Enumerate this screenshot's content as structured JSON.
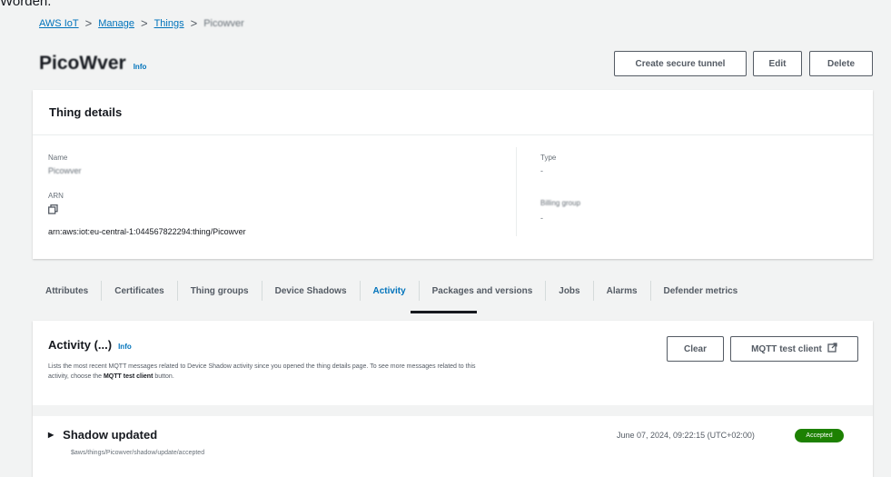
{
  "top_text": "Worden.",
  "breadcrumb": {
    "items": [
      "AWS IoT",
      "Manage",
      "Things"
    ],
    "current": "Picowver"
  },
  "thing": {
    "name": "PicoWver",
    "info_label": "Info"
  },
  "header_buttons": {
    "tunnel": "Create secure tunnel",
    "edit": "Edit",
    "delete": "Delete"
  },
  "details": {
    "title": "Thing details",
    "name_label": "Name",
    "name_value": "Picowver",
    "arn_label": "ARN",
    "arn_value": "arn:aws:iot:eu-central-1:044567822294:thing/Picowver",
    "type_label": "Type",
    "type_value": "-",
    "billing_label": "Billing group",
    "billing_value": "-"
  },
  "tabs": [
    "Attributes",
    "Certificates",
    "Thing groups",
    "Device Shadows",
    "Activity",
    "Packages and versions",
    "Jobs",
    "Alarms",
    "Defender metrics"
  ],
  "activity": {
    "title": "Activity (...)",
    "info_label": "Info",
    "desc_part1": "Lists the most recent MQTT messages related to Device Shadow activity since you opened the thing details page. To see more messages related to this activity, choose the ",
    "desc_bold": "MQTT test client",
    "desc_part2": " button.",
    "clear_label": "Clear",
    "mqtt_label": "MQTT test client",
    "item": {
      "title": "Shadow updated",
      "topic": "$aws/things/Picowver/shadow/update/accepted",
      "timestamp": "June 07, 2024, 09:22:15 (UTC+02:00)",
      "badge": "Accepted"
    }
  },
  "colors": {
    "link": "#0073bb",
    "accepted": "#1d8102",
    "text": "#16191f"
  }
}
